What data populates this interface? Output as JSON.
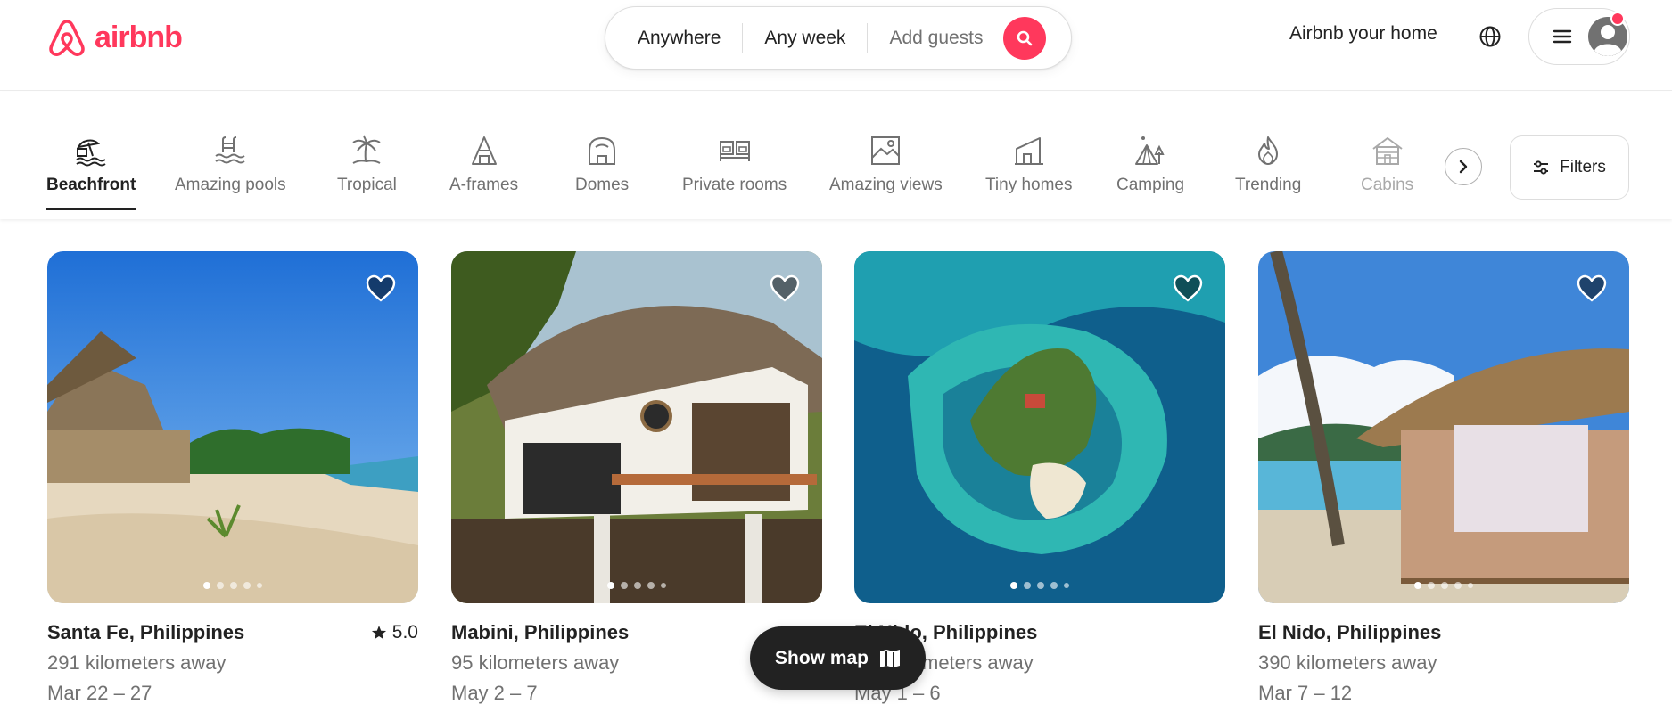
{
  "header": {
    "logo_text": "airbnb",
    "search": {
      "where": "Anywhere",
      "when": "Any week",
      "guests_placeholder": "Add guests"
    },
    "host_link": "Airbnb your home"
  },
  "categories": [
    {
      "label": "Beachfront",
      "icon": "beach-umbrella-icon",
      "active": true
    },
    {
      "label": "Amazing pools",
      "icon": "pool-icon"
    },
    {
      "label": "Tropical",
      "icon": "palm-tree-icon"
    },
    {
      "label": "A-frames",
      "icon": "a-frame-icon"
    },
    {
      "label": "Domes",
      "icon": "dome-icon"
    },
    {
      "label": "Private rooms",
      "icon": "bed-icon"
    },
    {
      "label": "Amazing views",
      "icon": "mountain-view-icon"
    },
    {
      "label": "Tiny homes",
      "icon": "tiny-home-icon"
    },
    {
      "label": "Camping",
      "icon": "tent-icon"
    },
    {
      "label": "Trending",
      "icon": "flame-icon"
    },
    {
      "label": "Cabins",
      "icon": "cabin-icon"
    }
  ],
  "filters_label": "Filters",
  "listings": [
    {
      "place": "Santa Fe, Philippines",
      "rating": "5.0",
      "distance": "291 kilometers away",
      "dates": "Mar 22 – 27"
    },
    {
      "place": "Mabini, Philippines",
      "rating": "",
      "distance": "95 kilometers away",
      "dates": "May 2 – 7"
    },
    {
      "place": "El Nido, Philippines",
      "rating": "",
      "distance": "meters away",
      "dates": "May 1 – 6"
    },
    {
      "place": "El Nido, Philippines",
      "rating": "",
      "distance": "390 kilometers away",
      "dates": "Mar 7 – 12"
    }
  ],
  "show_map_label": "Show map",
  "colors": {
    "brand": "#ff385c",
    "text": "#222222",
    "muted": "#717171"
  }
}
